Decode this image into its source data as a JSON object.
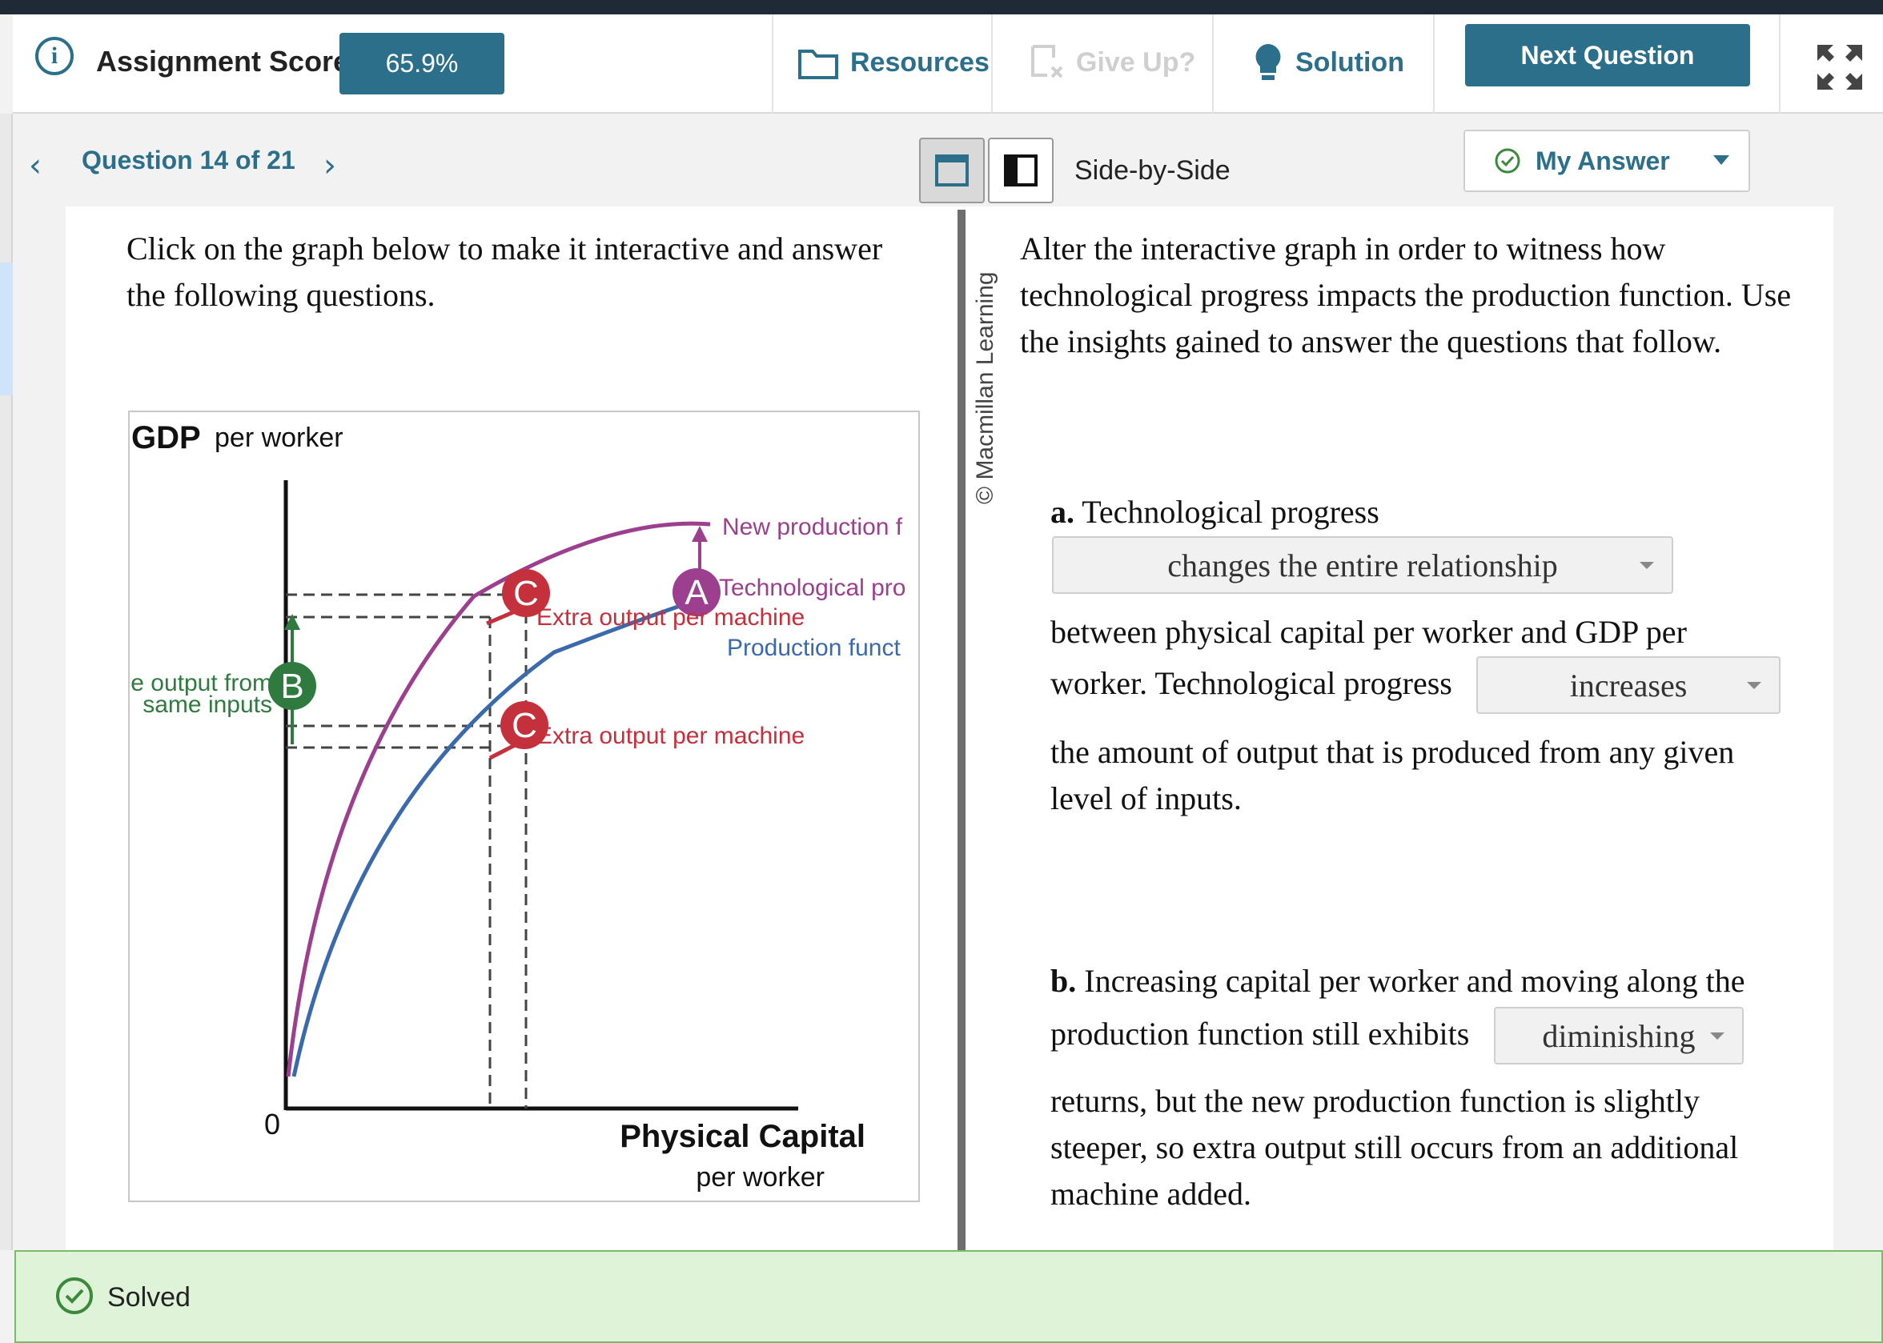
{
  "header": {
    "score_label": "Assignment Score:",
    "score_value": "65.9%",
    "resources": "Resources",
    "give_up": "Give Up?",
    "solution": "Solution",
    "next_question": "Next Question"
  },
  "subbar": {
    "question_label": "Question 14 of 21",
    "layout_label": "Side-by-Side",
    "my_answer": "My Answer"
  },
  "left": {
    "prompt": "Click on the graph below to make it interactive and answer the following questions."
  },
  "graph": {
    "y_title_bold": "GDP",
    "y_title_rest": "per worker",
    "x_title": "Physical Capital",
    "x_subtitle": "per worker",
    "origin": "0",
    "label_new": "New production f",
    "label_tech": "Technological pro",
    "label_prod": "Production funct",
    "label_extra_upper": "Extra output per machine",
    "label_extra_lower": "Extra output per machine",
    "label_more_output_1": "e output from",
    "label_more_output_2": "same inputs",
    "badge_a": "A",
    "badge_b": "B",
    "badge_c_upper": "C",
    "badge_c_lower": "C",
    "colors": {
      "new_curve": "#9b3f8e",
      "old_curve": "#3a6aab",
      "marker_c": "#c4303c",
      "marker_b": "#2f7a3f"
    }
  },
  "right": {
    "credit": "© Macmillan Learning",
    "intro": "Alter the interactive graph in order to witness how technological progress impacts the production function. Use the insights gained to answer the questions that follow.",
    "a_prefix": "a.",
    "a_line1": "Technological progress",
    "a_select1": "changes the entire relationship",
    "a_line2": "between physical capital per worker and GDP per",
    "a_line3": "worker. Technological progress",
    "a_select2": "increases",
    "a_line4": "the amount of output that is produced from any given",
    "a_line5": "level of inputs.",
    "b_prefix": "b.",
    "b_line1": "Increasing capital per worker and moving along the",
    "b_line2": "production function still exhibits",
    "b_select": "diminishing",
    "b_line3": "returns, but the new production function is slightly",
    "b_line4": "steeper, so extra output still occurs from an additional",
    "b_line5": "machine added."
  },
  "status": {
    "solved": "Solved"
  }
}
